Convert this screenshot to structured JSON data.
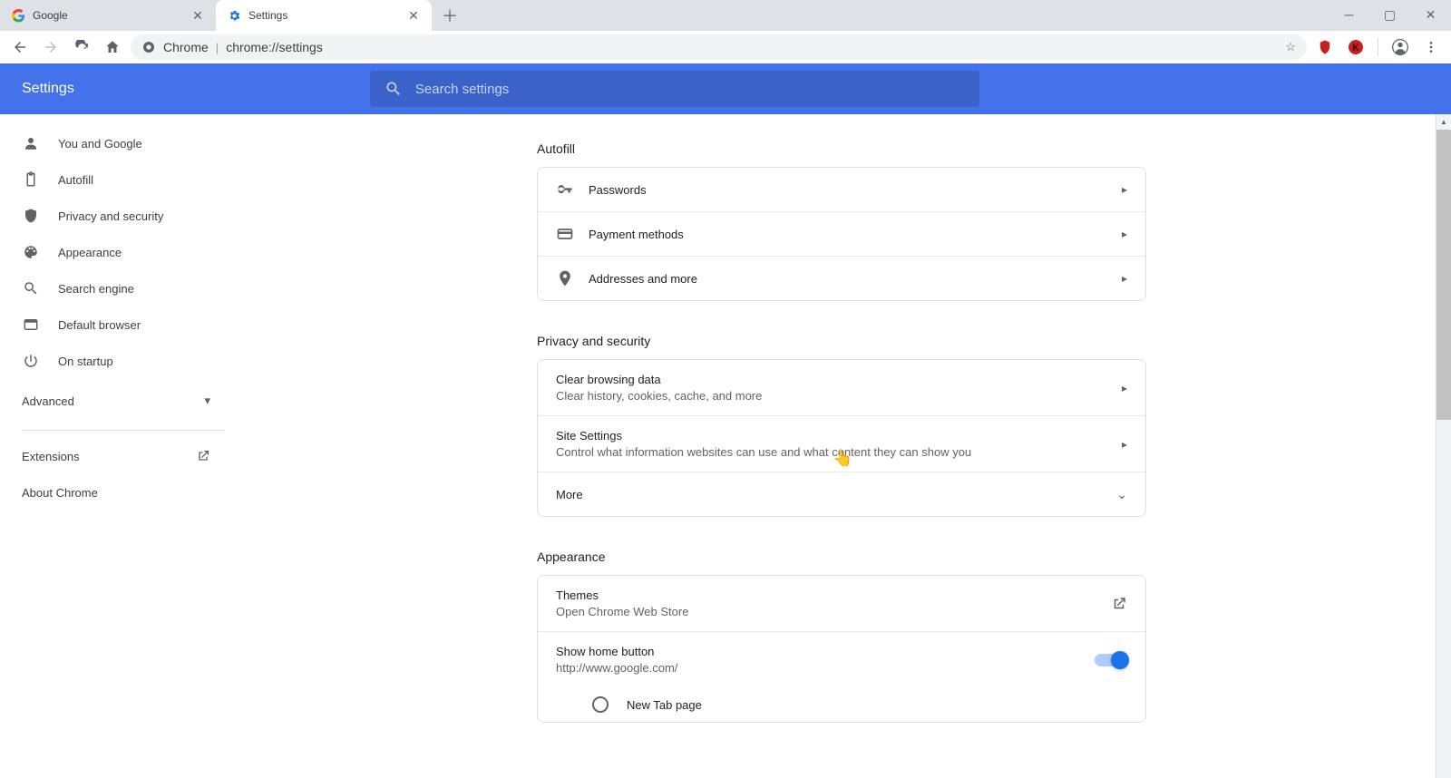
{
  "browser": {
    "tabs": [
      {
        "title": "Google"
      },
      {
        "title": "Settings"
      }
    ],
    "omnibox": {
      "scheme_label": "Chrome",
      "url_text": "chrome://settings"
    }
  },
  "header": {
    "title": "Settings",
    "search_placeholder": "Search settings"
  },
  "sidebar": {
    "items": [
      {
        "label": "You and Google"
      },
      {
        "label": "Autofill"
      },
      {
        "label": "Privacy and security"
      },
      {
        "label": "Appearance"
      },
      {
        "label": "Search engine"
      },
      {
        "label": "Default browser"
      },
      {
        "label": "On startup"
      }
    ],
    "advanced_label": "Advanced",
    "extensions_label": "Extensions",
    "about_label": "About Chrome"
  },
  "sections": {
    "autofill": {
      "title": "Autofill",
      "rows": {
        "passwords": "Passwords",
        "payment": "Payment methods",
        "addresses": "Addresses and more"
      }
    },
    "privacy": {
      "title": "Privacy and security",
      "clear": {
        "title": "Clear browsing data",
        "subtitle": "Clear history, cookies, cache, and more"
      },
      "site": {
        "title": "Site Settings",
        "subtitle": "Control what information websites can use and what content they can show you"
      },
      "more": "More"
    },
    "appearance": {
      "title": "Appearance",
      "themes": {
        "title": "Themes",
        "subtitle": "Open Chrome Web Store"
      },
      "homebtn": {
        "title": "Show home button",
        "subtitle": "http://www.google.com/"
      },
      "newtab_label": "New Tab page"
    }
  }
}
